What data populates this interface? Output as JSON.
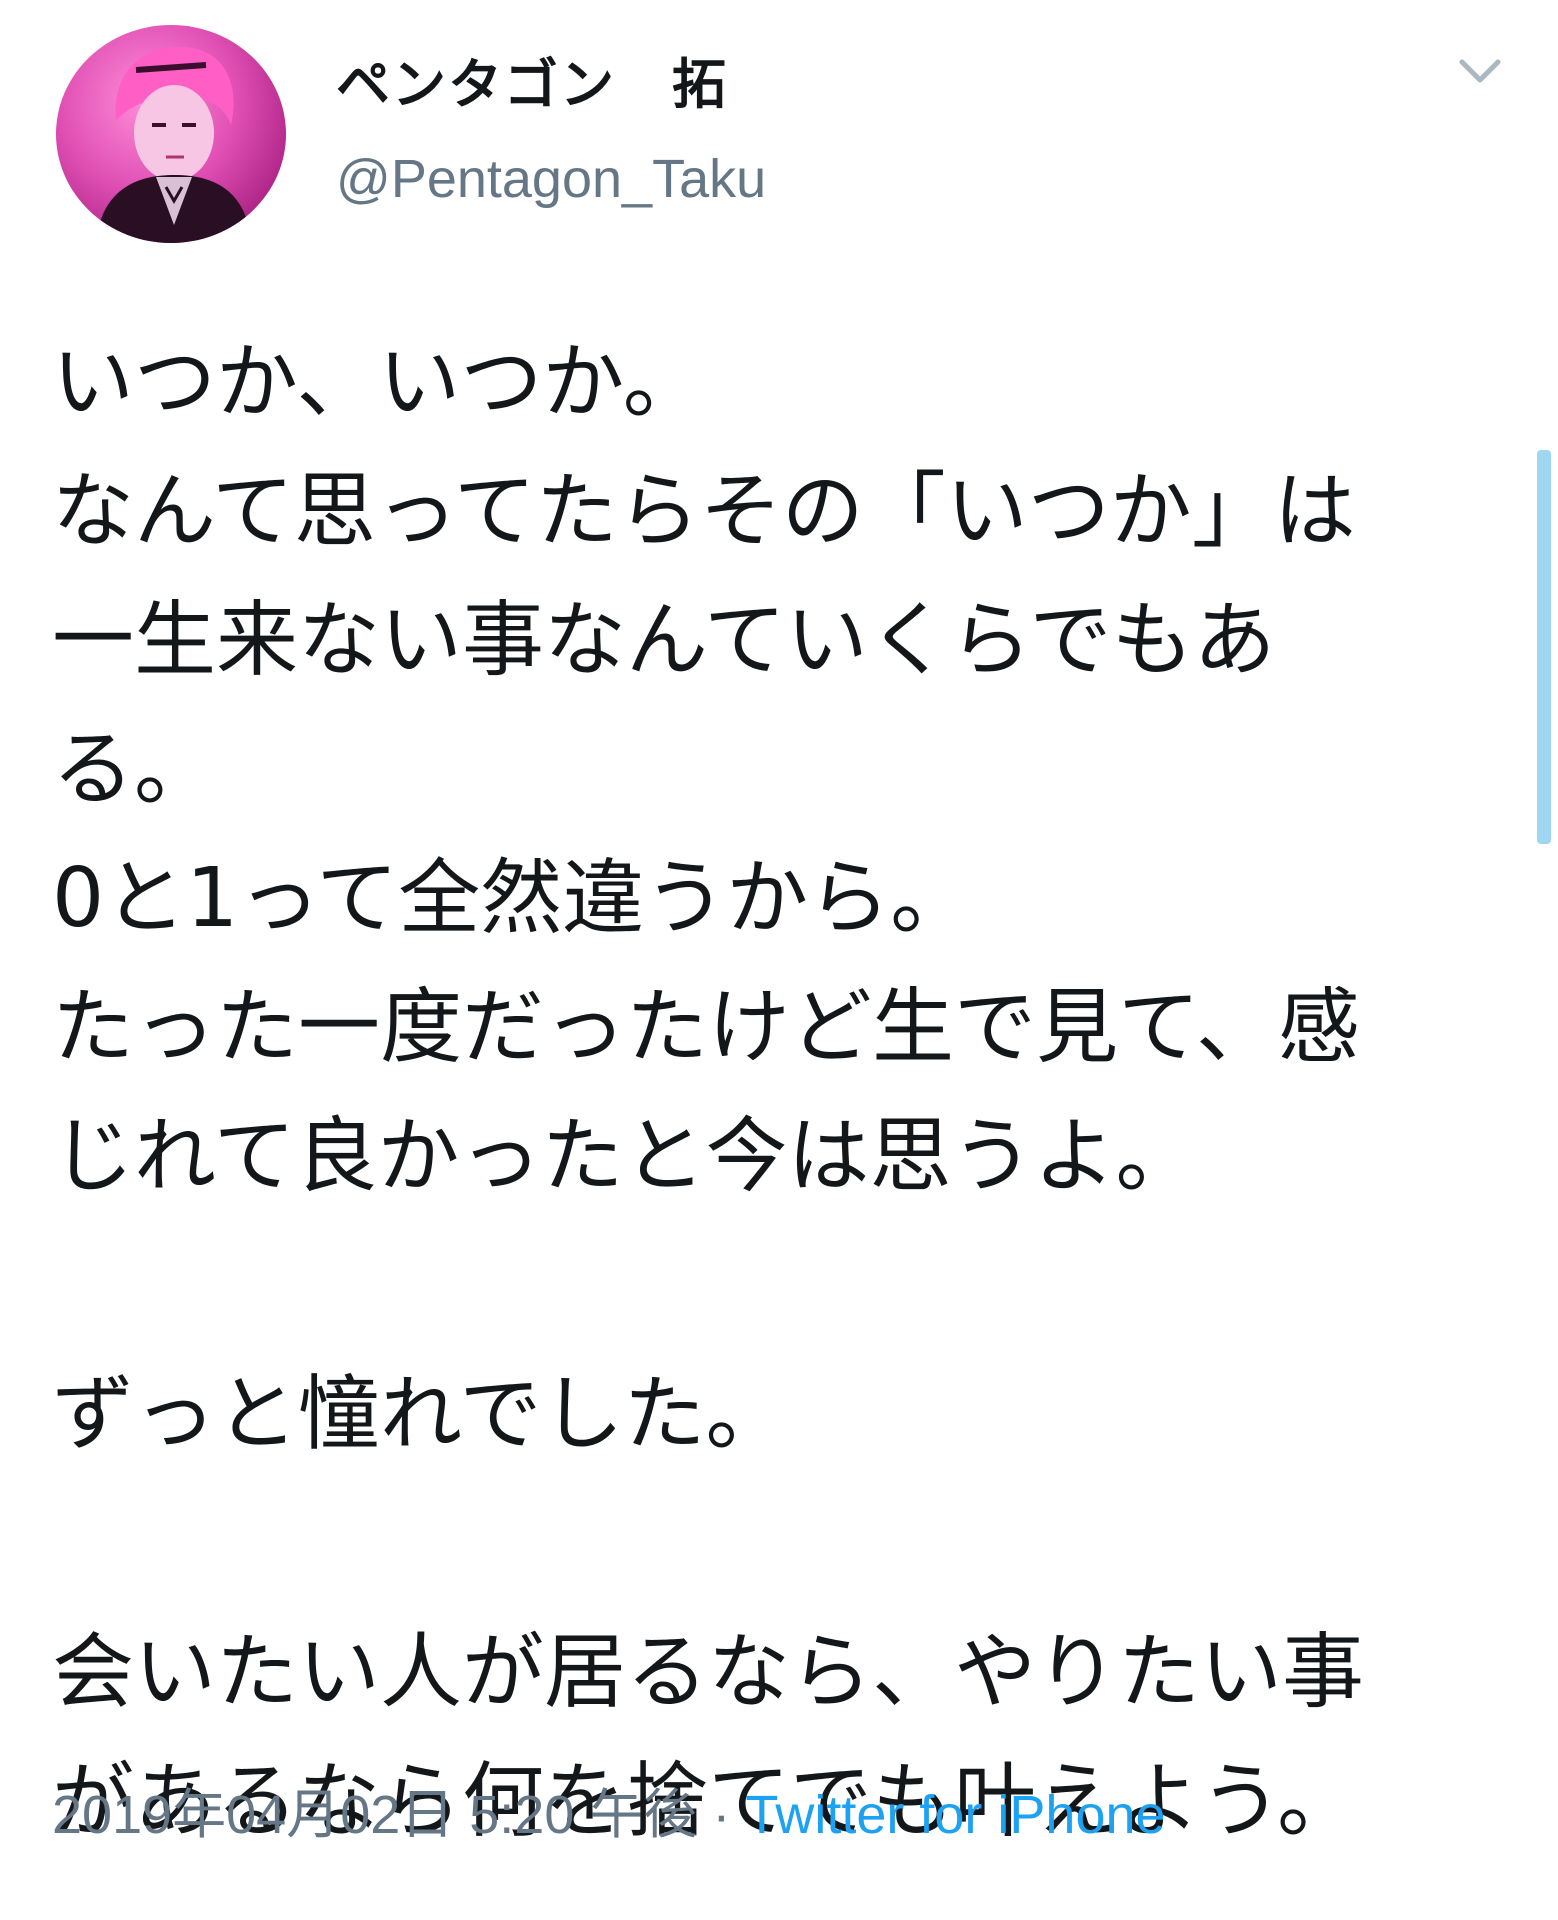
{
  "tweet": {
    "display_name": "ペンタゴン　拓",
    "handle": "@Pentagon_Taku",
    "text": "いつか、いつか。\nなんて思ってたらその「いつか」は\n一生来ない事なんていくらでもあ\nる。\n0と1って全然違うから。\nたった一度だったけど生で見て、感\nじれて良かったと今は思うよ。\n\nずっと憧れでした。\n\n会いたい人が居るなら、やりたい事\nがあるなら何を捨てでも叶えよう。",
    "timestamp": "2019年04月02日 5:20 午後",
    "separator": " · ",
    "source": "Twitter for iPhone"
  },
  "icons": {
    "avatar": "profile-photo",
    "menu": "chevron-down-icon"
  },
  "colors": {
    "text": "#14171a",
    "secondary": "#657786",
    "link": "#1da1f2",
    "avatar_bg": "#e04fb4"
  }
}
